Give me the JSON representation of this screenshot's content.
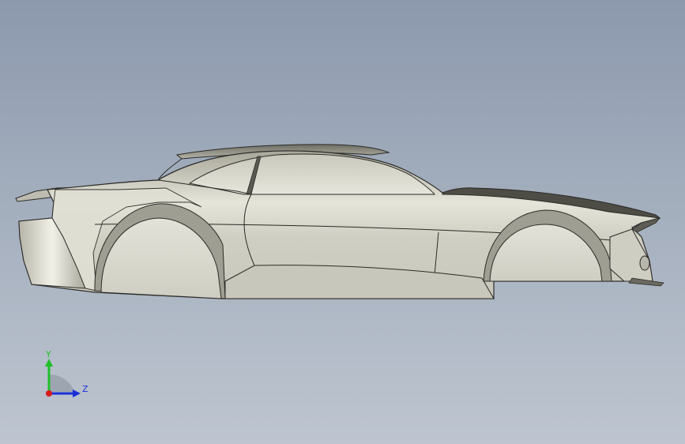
{
  "viewport": {
    "background_top": "#8c99ad",
    "background_bottom": "#bec5d0",
    "model": {
      "name": "car-body-side-view",
      "body_color": "#d9d8cc",
      "shadow_color": "#8e8d80",
      "edge_color": "#2b2b28"
    }
  },
  "triad": {
    "y_label": "Y",
    "z_label": "Z",
    "y_color": "#1fbf2a",
    "z_color": "#1b2fd6",
    "x_color": "#d61b1b"
  }
}
